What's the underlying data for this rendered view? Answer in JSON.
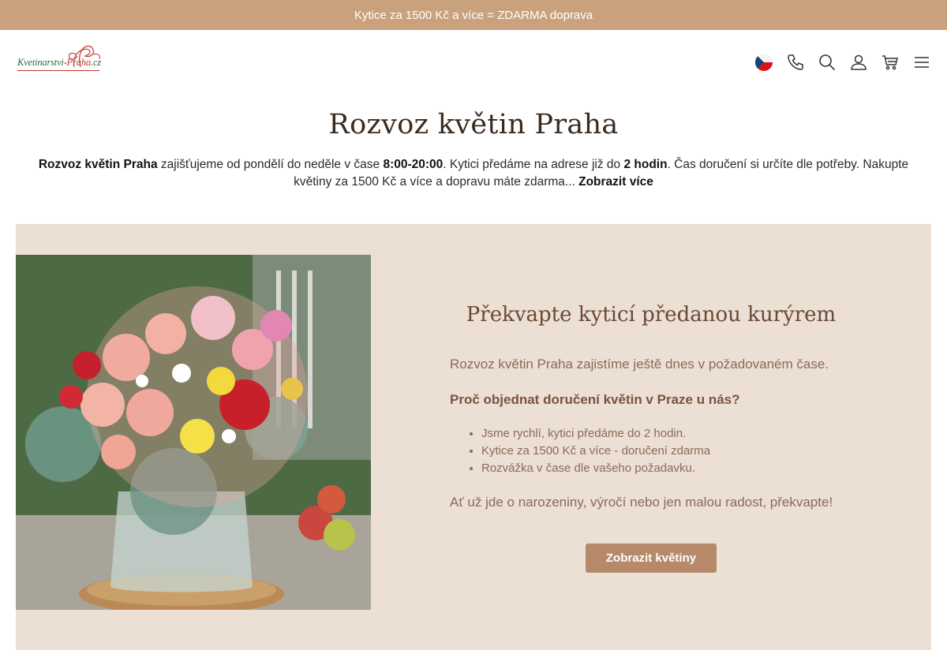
{
  "promo": {
    "text": "Kytice za 1500 Kč a více = ZDARMA doprava"
  },
  "header": {
    "logo_text_main": "Kvetinarstvi-",
    "logo_text_accent": "Praha",
    "logo_text_tld": ".cz",
    "icons": [
      "czech-flag-icon",
      "phone-icon",
      "search-icon",
      "user-icon",
      "cart-icon",
      "menu-icon"
    ]
  },
  "page": {
    "title": "Rozvoz květin Praha",
    "intro": {
      "b1": "Rozvoz květin Praha",
      "t1": " zajišťujeme od pondělí do neděle v čase ",
      "b2": "8:00-20:00",
      "t2": ". Kytici předáme na adrese již do ",
      "b3": "2 hodin",
      "t3": ". Čas doručení si určíte dle potřeby. Nakupte květiny za 1500 Kč a více a dopravu máte zdarma...",
      "more_link": "Zobrazit více"
    }
  },
  "hero": {
    "title": "Překvapte kyticí předanou kurýrem",
    "lead": "Rozvoz květin Praha zajistíme ještě dnes v požadovaném čase.",
    "subheading": "Proč objednat doručení květin v Praze u nás?",
    "bullets": [
      "Jsme rychlí, kytici předáme do 2 hodin.",
      "Kytice za 1500 Kč a více - doručení zdarma",
      "Rozvážka v čase dle vašeho požadavku."
    ],
    "closing": "Ať už jde o narozeniny, výročí nebo jen malou radost, překvapte!",
    "button_label": "Zobrazit květiny"
  },
  "colors": {
    "promo_bg": "#c9a27d",
    "hero_bg": "#ecdfd3",
    "button_bg": "#b5896a",
    "title_brown": "#6a4a35"
  }
}
